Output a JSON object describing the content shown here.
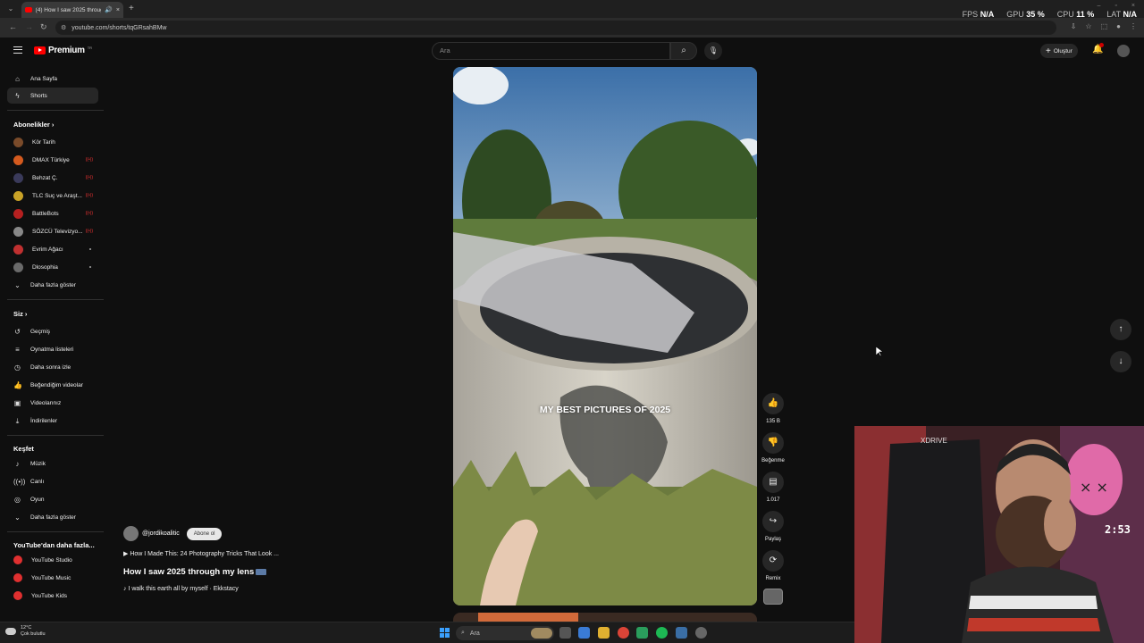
{
  "browser": {
    "tab_title": "(4) How I saw 2025 through",
    "url": "youtube.com/shorts/tqGRsahBMw"
  },
  "overlay": {
    "fps_label": "FPS",
    "fps_value": "N/A",
    "gpu_label": "GPU",
    "gpu_value": "35 %",
    "cpu_label": "CPU",
    "cpu_value": "11 %",
    "lat_label": "LAT",
    "lat_value": "N/A"
  },
  "header": {
    "logo_text": "Premium",
    "logo_tm": "TR",
    "search_placeholder": "Ara",
    "create_label": "Oluştur"
  },
  "sidebar": {
    "main": [
      {
        "label": "Ana Sayfa",
        "icon": "home-icon"
      },
      {
        "label": "Shorts",
        "icon": "shorts-icon"
      }
    ],
    "subs_heading": "Abonelikler",
    "subs": [
      {
        "label": "Kör Tarih",
        "color": "#7a4b2a"
      },
      {
        "label": "DMAX Türkiye",
        "color": "#d45a1e"
      },
      {
        "label": "Behzat Ç.",
        "color": "#3a3a5a"
      },
      {
        "label": "TLC Suç ve Araşt...",
        "color": "#c9a227"
      },
      {
        "label": "BattleBots",
        "color": "#b52020"
      },
      {
        "label": "SÖZCÜ Televizyo...",
        "color": "#888888"
      },
      {
        "label": "Evrim Ağacı",
        "color": "#c03030"
      },
      {
        "label": "Dlosophia",
        "color": "#6a6a6a"
      }
    ],
    "subs_more": "Daha fazla göster",
    "you_heading": "Siz",
    "you": [
      {
        "label": "Geçmiş",
        "icon": "history-icon"
      },
      {
        "label": "Oynatma listeleri",
        "icon": "playlist-icon"
      },
      {
        "label": "Daha sonra izle",
        "icon": "watch-later-icon"
      },
      {
        "label": "Beğendiğim videolar",
        "icon": "like-icon"
      },
      {
        "label": "Videolarınız",
        "icon": "your-videos-icon"
      },
      {
        "label": "İndirilenler",
        "icon": "download-icon"
      }
    ],
    "explore_heading": "Keşfet",
    "explore": [
      {
        "label": "Müzik",
        "icon": "music-icon"
      },
      {
        "label": "Canlı",
        "icon": "live-icon"
      },
      {
        "label": "Oyun",
        "icon": "gaming-icon"
      }
    ],
    "explore_more": "Daha fazla göster",
    "more_heading": "YouTube'dan daha fazla...",
    "more": [
      {
        "label": "YouTube Studio"
      },
      {
        "label": "YouTube Music"
      },
      {
        "label": "YouTube Kids"
      }
    ]
  },
  "short": {
    "caption": "MY BEST PICTURES OF 2025",
    "channel": "@jordikoalitic",
    "subscribe_label": "Abone ol",
    "related": "How I Made This: 24 Photography Tricks That Look ...",
    "title": "How I saw 2025 through my lens",
    "music": "I walk this earth all by myself · Ekkstacy",
    "likes": "135 B",
    "dislike_label": "Beğenme",
    "comments": "1.017",
    "share_label": "Paylaş",
    "remix_label": "Remix"
  },
  "webcam": {
    "clock": "2:53",
    "chair_brand": "XDRIVE"
  },
  "taskbar": {
    "temp": "12°C",
    "weather": "Çok bulutlu",
    "search_label": "Ara"
  }
}
